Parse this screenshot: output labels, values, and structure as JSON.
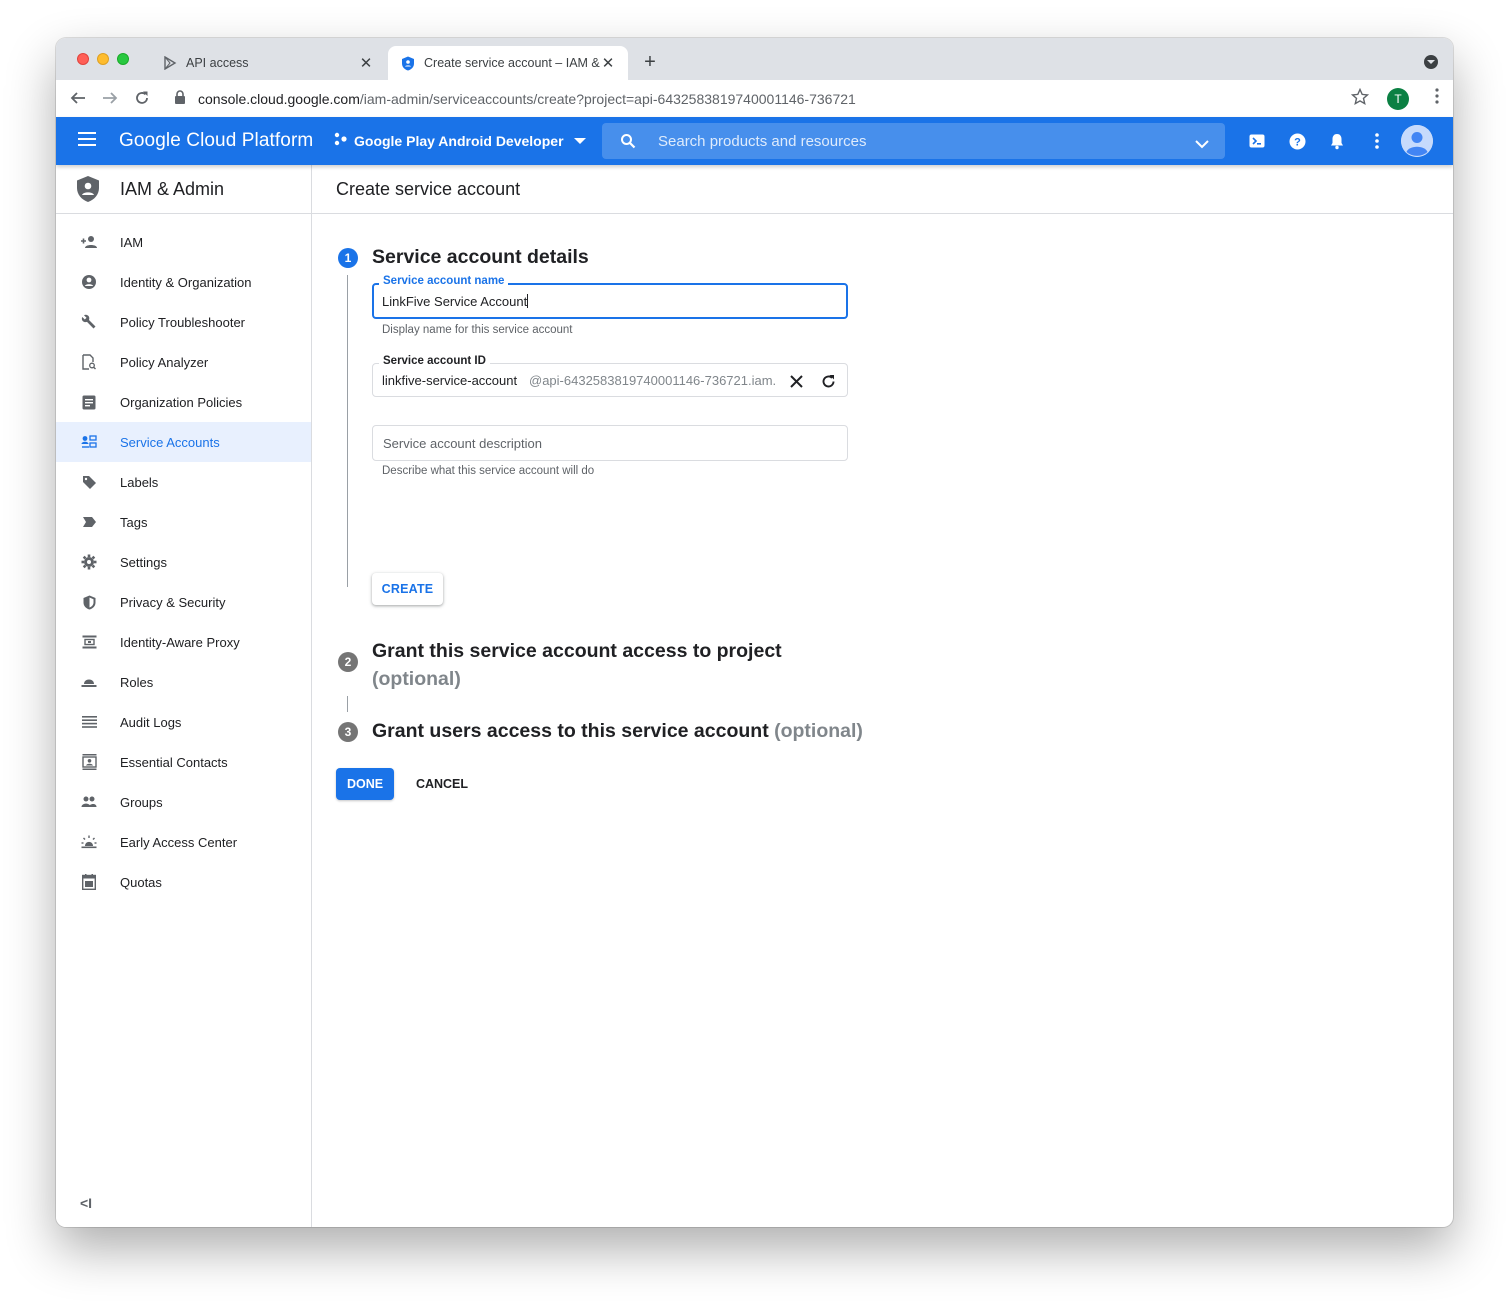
{
  "browser": {
    "tabs": [
      {
        "title": "API access"
      },
      {
        "title": "Create service account – IAM & Admin"
      }
    ],
    "url_host": "console.cloud.google.com",
    "url_path": "/iam-admin/serviceaccounts/create?project=api-6432583819740001146-736721",
    "profile_initial": "T"
  },
  "header": {
    "brand": "Google Cloud Platform",
    "project": "Google Play Android Developer",
    "search_placeholder": "Search products and resources"
  },
  "sidebar": {
    "title": "IAM & Admin",
    "items": [
      {
        "label": "IAM",
        "icon": "person-add-icon"
      },
      {
        "label": "Identity & Organization",
        "icon": "account-circle-icon"
      },
      {
        "label": "Policy Troubleshooter",
        "icon": "wrench-icon"
      },
      {
        "label": "Policy Analyzer",
        "icon": "document-search-icon"
      },
      {
        "label": "Organization Policies",
        "icon": "document-list-icon"
      },
      {
        "label": "Service Accounts",
        "icon": "service-account-icon",
        "active": true
      },
      {
        "label": "Labels",
        "icon": "label-tag-icon"
      },
      {
        "label": "Tags",
        "icon": "tag-arrow-icon"
      },
      {
        "label": "Settings",
        "icon": "gear-icon"
      },
      {
        "label": "Privacy & Security",
        "icon": "shield-icon"
      },
      {
        "label": "Identity-Aware Proxy",
        "icon": "proxy-icon"
      },
      {
        "label": "Roles",
        "icon": "hat-icon"
      },
      {
        "label": "Audit Logs",
        "icon": "list-lines-icon"
      },
      {
        "label": "Essential Contacts",
        "icon": "contact-card-icon"
      },
      {
        "label": "Groups",
        "icon": "group-icon"
      },
      {
        "label": "Early Access Center",
        "icon": "sunrise-icon"
      },
      {
        "label": "Quotas",
        "icon": "calendar-icon"
      }
    ],
    "collapse_label": "<I"
  },
  "main": {
    "page_title": "Create service account",
    "step1": {
      "number": "1",
      "title": "Service account details",
      "name_label": "Service account name",
      "name_value": "LinkFive Service Account",
      "name_helper": "Display name for this service account",
      "id_label": "Service account ID",
      "id_value": "linkfive-service-account",
      "id_suffix": "@api-6432583819740001146-736721.iam.",
      "description_placeholder": "Service account description",
      "description_helper": "Describe what this service account will do",
      "create_button": "CREATE"
    },
    "step2": {
      "number": "2",
      "title": "Grant this service account access to project",
      "optional": "(optional)"
    },
    "step3": {
      "number": "3",
      "title": "Grant users access to this service account",
      "optional": "(optional)"
    },
    "done_button": "DONE",
    "cancel_button": "CANCEL"
  },
  "colors": {
    "brand_blue": "#1a73e8",
    "active_bg": "#e8f0fe"
  }
}
